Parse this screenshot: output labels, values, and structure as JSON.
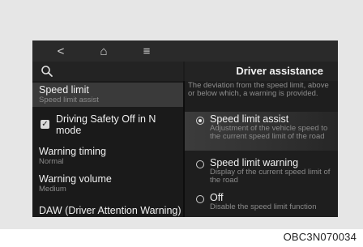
{
  "nav": {
    "back_glyph": "<",
    "home_glyph": "⌂",
    "menu_glyph": "≡"
  },
  "header": {
    "title": "Driver assistance"
  },
  "menu": {
    "items": [
      {
        "label": "Speed limit",
        "sub": "Speed limit assist"
      },
      {
        "label": "Driving Safety Off in N mode",
        "checked": true
      },
      {
        "label": "Warning timing",
        "sub": "Normal"
      },
      {
        "label": "Warning volume",
        "sub": "Medium"
      },
      {
        "label": "DAW (Driver Attention Warning)"
      }
    ]
  },
  "panel": {
    "description": "The deviation from the speed limit, above or below which, a warning is provided.",
    "options": [
      {
        "label": "Speed limit assist",
        "sub": "Adjustment of the vehicle speed to the current speed limit of the road",
        "selected": true
      },
      {
        "label": "Speed limit warning",
        "sub": "Display of the current speed limit of the road",
        "selected": false
      },
      {
        "label": "Off",
        "sub": "Disable the speed limit function",
        "selected": false
      }
    ]
  },
  "caption": "OBC3N070034",
  "colors": {
    "screen_bg": "#1c1c1c",
    "selected_bg": "#3a3a3a",
    "text": "#f0f0f0",
    "subtext": "#8a8a8a"
  }
}
